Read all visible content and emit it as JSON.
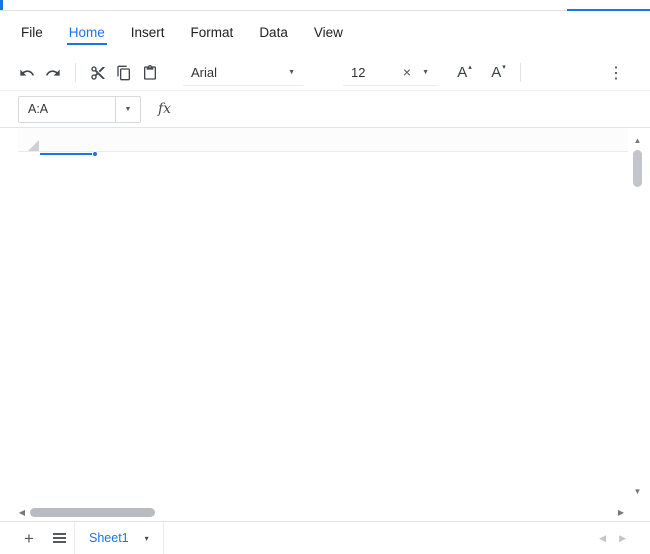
{
  "colors": {
    "accent": "#1a73e8"
  },
  "menubar": {
    "active_item": "Home",
    "items": [
      {
        "label": "File"
      },
      {
        "label": "Home"
      },
      {
        "label": "Insert"
      },
      {
        "label": "Format"
      },
      {
        "label": "Data"
      },
      {
        "label": "View"
      }
    ]
  },
  "toolbar": {
    "font_name": "Arial",
    "font_size": "12",
    "clear_glyph": "×",
    "caret_glyph": "▼",
    "font_up_letter": "A",
    "font_up_mark": "▴",
    "font_down_letter": "A",
    "font_down_mark": "▾",
    "more_glyph": "⋮"
  },
  "formula_bar": {
    "cell_ref": "A:A",
    "caret_glyph": "▼",
    "fx_label": "fx"
  },
  "scrollbars": {
    "up_glyph": "▲",
    "down_glyph": "▼",
    "left_glyph": "◀",
    "right_glyph": "▶"
  },
  "sheetbar": {
    "add_glyph": "+",
    "sheets": [
      {
        "name": "Sheet1",
        "active": true
      }
    ],
    "caret_glyph": "▾",
    "nav_left_glyph": "◀",
    "nav_right_glyph": "▶"
  }
}
